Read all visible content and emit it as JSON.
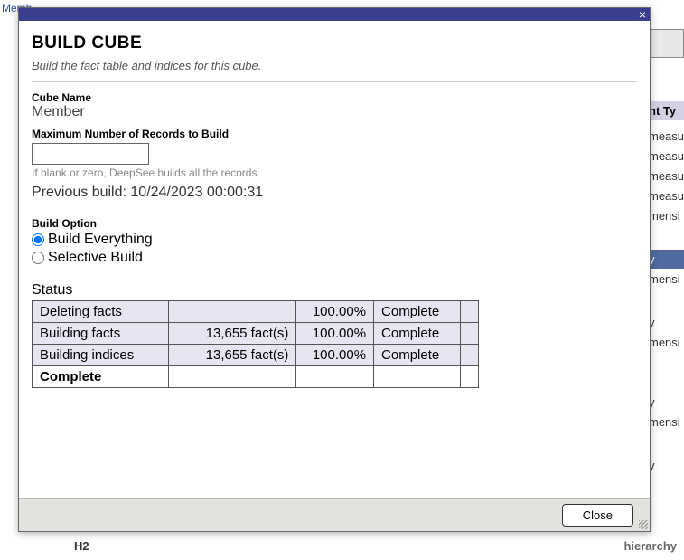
{
  "background": {
    "top_link": "Memb",
    "header_type": "nt Ty",
    "rows": [
      {
        "text": "measu"
      },
      {
        "text": "measu"
      },
      {
        "text": "measu"
      },
      {
        "text": "measu"
      },
      {
        "text": "mensi"
      },
      {
        "text": "y",
        "selected": true
      },
      {
        "text": "mensi"
      },
      {
        "text": "y"
      },
      {
        "text": "mensi"
      },
      {
        "text": "y"
      },
      {
        "text": "mensi"
      },
      {
        "text": "y"
      }
    ],
    "bottom_left": "H2",
    "bottom_right": "hierarchy"
  },
  "dialog": {
    "title": "BUILD CUBE",
    "subtitle": "Build the fact table and indices for this cube.",
    "cube_name_label": "Cube Name",
    "cube_name_value": "Member",
    "max_records_label": "Maximum Number of Records to Build",
    "max_records_value": "",
    "max_records_hint": "If blank or zero, DeepSee builds all the records.",
    "previous_build": "Previous build: 10/24/2023 00:00:31",
    "build_option_label": "Build Option",
    "options": {
      "everything": "Build Everything",
      "selective": "Selective Build"
    },
    "status_label": "Status",
    "status_rows": [
      {
        "task": "Deleting facts",
        "count": "",
        "pct": "100.00%",
        "state": "Complete"
      },
      {
        "task": "Building facts",
        "count": "13,655 fact(s)",
        "pct": "100.00%",
        "state": "Complete"
      },
      {
        "task": "Building indices",
        "count": "13,655 fact(s)",
        "pct": "100.00%",
        "state": "Complete"
      },
      {
        "task": "Complete",
        "count": "",
        "pct": "",
        "state": ""
      }
    ],
    "close_label": "Close"
  }
}
